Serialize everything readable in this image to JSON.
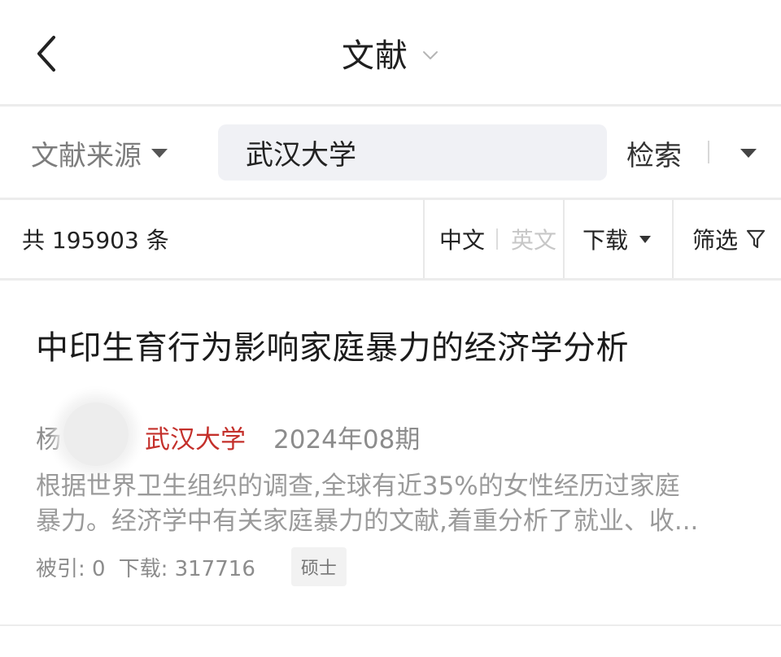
{
  "header": {
    "title": "文献"
  },
  "search": {
    "source_label": "文献来源",
    "query": "武汉大学",
    "search_label": "检索"
  },
  "filter_bar": {
    "count_text": "共 195903 条",
    "lang_zh": "中文",
    "lang_en": "英文",
    "download_label": "下载",
    "filter_label": "筛选"
  },
  "results": [
    {
      "title": "中印生育行为影响家庭暴力的经济学分析",
      "author": "杨",
      "institution": "武汉大学",
      "issue": "2024年08期",
      "abstract_line1": "根据世界卫生组织的调查,全球有近35%的女性经历过家庭",
      "abstract_line2": "暴力。经济学中有关家庭暴力的文献,着重分析了就业、收...",
      "cited": "被引: 0",
      "downloads": "下载: 317716",
      "tag": "硕士"
    }
  ],
  "colors": {
    "institution": "#c4302b",
    "muted_text": "#8c8c8c",
    "search_bg": "#f0f1f5",
    "divider": "#ececec"
  },
  "icons": {
    "back": "chevron-left-icon",
    "title_dropdown": "chevron-down-icon",
    "source_dropdown": "caret-down-icon",
    "more": "caret-down-icon",
    "download_dropdown": "caret-down-icon",
    "filter": "funnel-icon"
  }
}
